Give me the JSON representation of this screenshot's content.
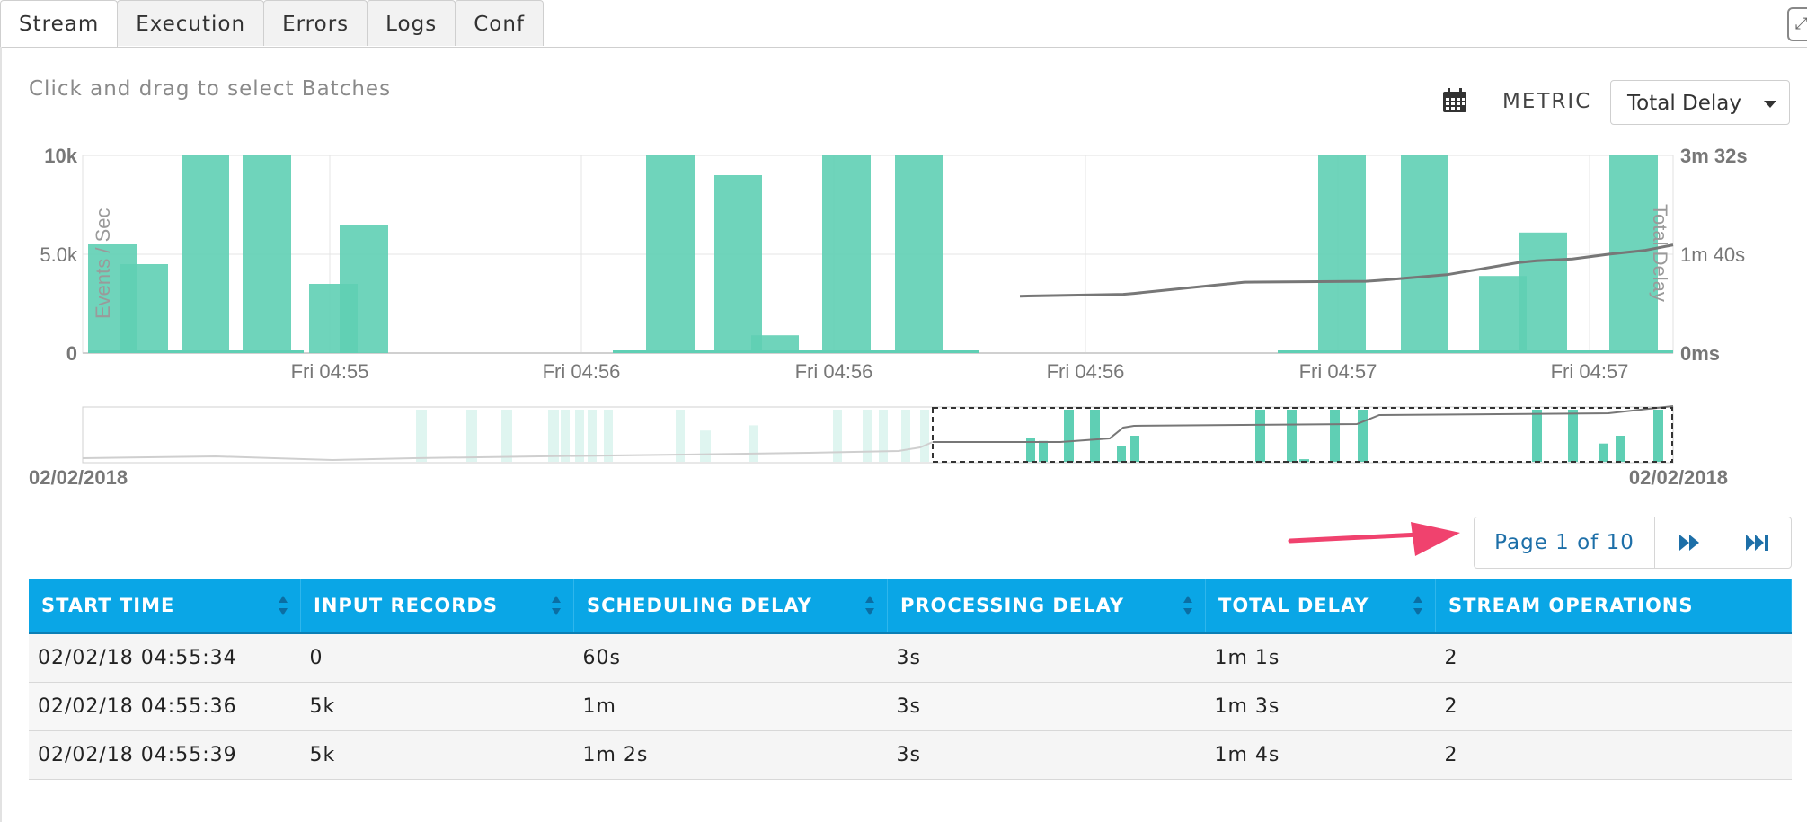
{
  "tabs": [
    {
      "label": "Stream",
      "active": true
    },
    {
      "label": "Execution",
      "active": false
    },
    {
      "label": "Errors",
      "active": false
    },
    {
      "label": "Logs",
      "active": false
    },
    {
      "label": "Conf",
      "active": false
    }
  ],
  "header": {
    "hint": "Click and drag to select Batches",
    "metric_label": "METRIC",
    "metric_value": "Total Delay",
    "calendar_icon": "calendar-icon"
  },
  "chart_data": {
    "type": "bar",
    "title": "",
    "ylabel": "Events / Sec",
    "y2label": "Total Delay",
    "y_ticks": [
      "10k",
      "5.0k",
      "0"
    ],
    "y2_ticks": [
      "3m 32s",
      "1m 40s",
      "0ms"
    ],
    "x_ticks": [
      "Fri 04:55",
      "Fri 04:56",
      "Fri 04:56",
      "Fri 04:56",
      "Fri 04:57",
      "Fri 04:57"
    ],
    "ylim": [
      0,
      10000
    ],
    "y2lim_seconds": [
      0,
      212
    ],
    "bars": [
      5500,
      4500,
      10000,
      10000,
      3500,
      6500,
      10000,
      9000,
      900,
      10000,
      10000,
      10000,
      10000,
      3900,
      6100,
      10000
    ],
    "delay_seconds": [
      61,
      63,
      64,
      76,
      77,
      78,
      84,
      97,
      99,
      101,
      106,
      110,
      116
    ],
    "grid": true,
    "overview": {
      "start_label": "02/02/2018",
      "end_label": "02/02/2018"
    },
    "colors": {
      "bar": "#5fcfb4",
      "line": "#777777"
    }
  },
  "pager": {
    "label": "Page 1 of 10",
    "next_icon": "fast-forward-icon",
    "last_icon": "skip-to-end-icon"
  },
  "table": {
    "columns": [
      "START TIME",
      "INPUT RECORDS",
      "SCHEDULING DELAY",
      "PROCESSING DELAY",
      "TOTAL DELAY",
      "STREAM OPERATIONS"
    ],
    "rows": [
      [
        "02/02/18 04:55:34",
        "0",
        "60s",
        "3s",
        "1m 1s",
        "2"
      ],
      [
        "02/02/18 04:55:36",
        "5k",
        "1m",
        "3s",
        "1m 3s",
        "2"
      ],
      [
        "02/02/18 04:55:39",
        "5k",
        "1m 2s",
        "3s",
        "1m 4s",
        "2"
      ]
    ]
  }
}
